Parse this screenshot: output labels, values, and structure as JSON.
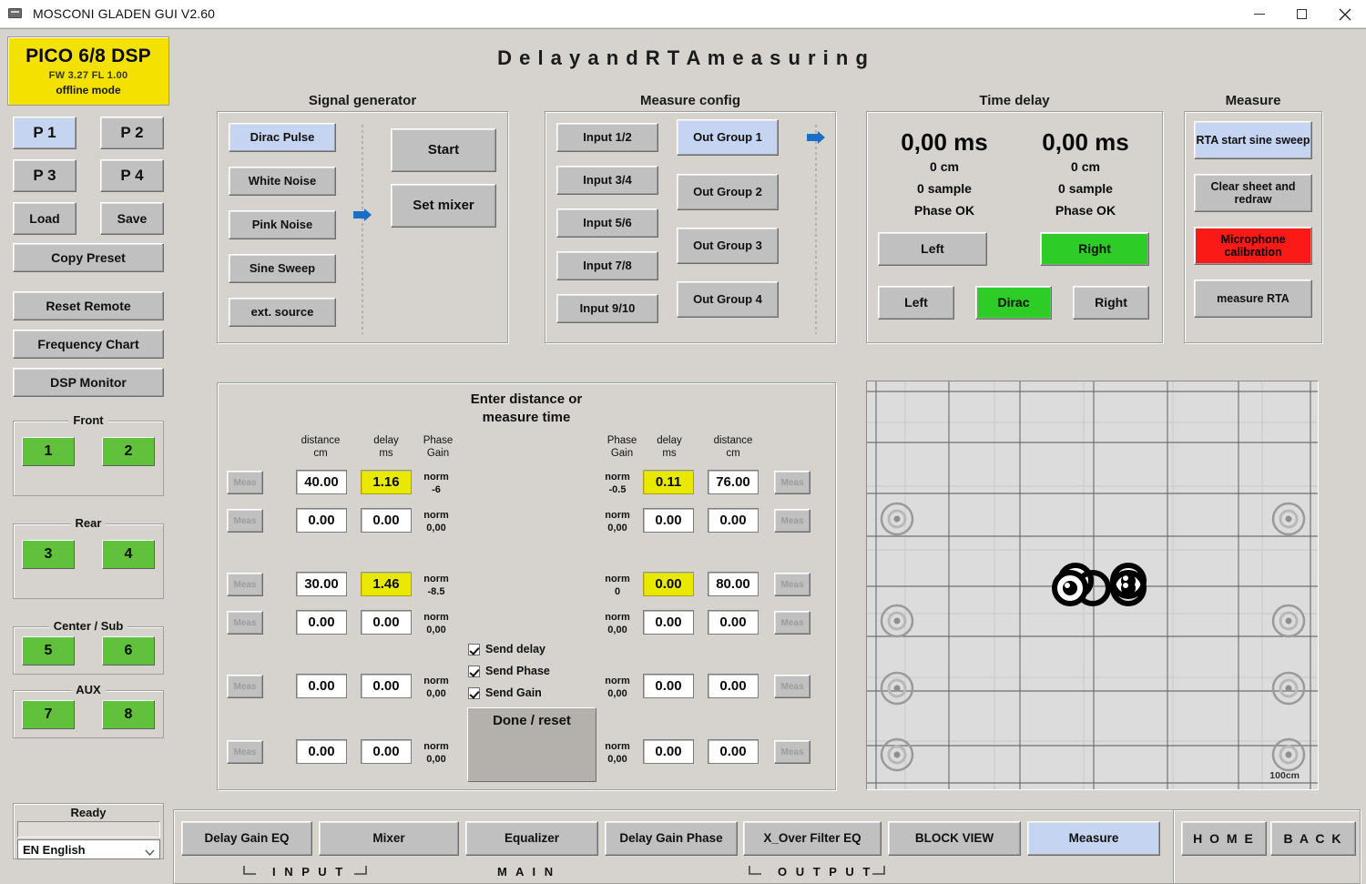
{
  "window": {
    "title": "MOSCONI GLADEN GUI V2.60",
    "minimize": "—",
    "maximize": "□",
    "close": "✕"
  },
  "page_title": "D e l a y   a n d   R T A   m e a s u r i n g",
  "device": {
    "name": "PICO 6/8 DSP",
    "firmware": "FW 3.27   FL 1.00",
    "mode": "offline mode"
  },
  "sidebar": {
    "presets": [
      "P 1",
      "P 2",
      "P 3",
      "P 4"
    ],
    "load": "Load",
    "save": "Save",
    "copy_preset": "Copy Preset",
    "reset_remote": "Reset Remote",
    "frequency_chart": "Frequency Chart",
    "dsp_monitor": "DSP Monitor",
    "channel_groups": [
      {
        "title": "Front",
        "channels": [
          "1",
          "2"
        ]
      },
      {
        "title": "Rear",
        "channels": [
          "3",
          "4"
        ]
      },
      {
        "title": "Center / Sub",
        "channels": [
          "5",
          "6"
        ]
      },
      {
        "title": "AUX",
        "channels": [
          "7",
          "8"
        ]
      }
    ],
    "status_title": "Ready",
    "status_value": "",
    "language": "EN English"
  },
  "signal_generator": {
    "title": "Signal generator",
    "sources": [
      "Dirac Pulse",
      "White Noise",
      "Pink Noise",
      "Sine Sweep",
      "ext. source"
    ],
    "selected_source": "Dirac Pulse",
    "start": "Start",
    "set_mixer": "Set mixer"
  },
  "measure_config": {
    "title": "Measure config",
    "inputs": [
      "Input 1/2",
      "Input 3/4",
      "Input 5/6",
      "Input 7/8",
      "Input 9/10"
    ],
    "out_groups": [
      "Out Group 1",
      "Out Group 2",
      "Out Group 3",
      "Out Group 4"
    ],
    "selected_out_group": "Out Group 1"
  },
  "time_delay": {
    "title": "Time delay",
    "left": {
      "ms": "0,00 ms",
      "cm": "0 cm",
      "sample": "0 sample",
      "phase": "Phase OK",
      "button": "Left"
    },
    "right": {
      "ms": "0,00 ms",
      "cm": "0 cm",
      "sample": "0 sample",
      "phase": "Phase OK",
      "button": "Right"
    },
    "row_buttons": [
      "Left",
      "Dirac",
      "Right"
    ],
    "active_row_button": "Dirac"
  },
  "measure": {
    "title": "Measure",
    "buttons": [
      {
        "label": "RTA start sine sweep",
        "state": "selected"
      },
      {
        "label": "Clear sheet and redraw",
        "state": "normal"
      },
      {
        "label": "Microphone calibration",
        "state": "alert"
      },
      {
        "label": "measure RTA",
        "state": "normal"
      }
    ]
  },
  "data_panel": {
    "title_line1": "Enter distance or",
    "title_line2": "measure time",
    "left_headers": [
      {
        "l1": "distance",
        "l2": "cm"
      },
      {
        "l1": "delay",
        "l2": "ms"
      },
      {
        "l1": "Phase",
        "l2": "Gain"
      }
    ],
    "right_headers": [
      {
        "l1": "Phase",
        "l2": "Gain"
      },
      {
        "l1": "delay",
        "l2": "ms"
      },
      {
        "l1": "distance",
        "l2": "cm"
      }
    ],
    "meas_button_label": "Meas",
    "left_rows": [
      {
        "distance": "40.00",
        "delay": "1.16",
        "delay_hl": true,
        "norm": "norm",
        "gain": "-6"
      },
      {
        "distance": "0.00",
        "delay": "0.00",
        "delay_hl": false,
        "norm": "norm",
        "gain": "0,00"
      },
      {
        "distance": "30.00",
        "delay": "1.46",
        "delay_hl": true,
        "norm": "norm",
        "gain": "-8.5"
      },
      {
        "distance": "0.00",
        "delay": "0.00",
        "delay_hl": false,
        "norm": "norm",
        "gain": "0,00"
      },
      {
        "distance": "0.00",
        "delay": "0.00",
        "delay_hl": false,
        "norm": "norm",
        "gain": "0,00"
      },
      {
        "distance": "0.00",
        "delay": "0.00",
        "delay_hl": false,
        "norm": "norm",
        "gain": "0,00"
      }
    ],
    "right_rows": [
      {
        "norm": "norm",
        "gain": "-0.5",
        "delay": "0.11",
        "delay_hl": true,
        "distance": "76.00"
      },
      {
        "norm": "norm",
        "gain": "0,00",
        "delay": "0.00",
        "delay_hl": false,
        "distance": "0.00"
      },
      {
        "norm": "norm",
        "gain": "0",
        "delay": "0.00",
        "delay_hl": true,
        "distance": "80.00"
      },
      {
        "norm": "norm",
        "gain": "0,00",
        "delay": "0.00",
        "delay_hl": false,
        "distance": "0.00"
      },
      {
        "norm": "norm",
        "gain": "0,00",
        "delay": "0.00",
        "delay_hl": false,
        "distance": "0.00"
      },
      {
        "norm": "norm",
        "gain": "0,00",
        "delay": "0.00",
        "delay_hl": false,
        "distance": "0.00"
      }
    ],
    "checkboxes": [
      {
        "label": "Send delay",
        "checked": true
      },
      {
        "label": "Send Phase",
        "checked": true
      },
      {
        "label": "Send Gain",
        "checked": true
      }
    ],
    "done_reset": "Done / reset"
  },
  "diagram": {
    "scale_label": "100cm"
  },
  "bottom": {
    "tabs": [
      {
        "label": "Delay Gain EQ",
        "state": "normal"
      },
      {
        "label": "Mixer",
        "state": "normal"
      },
      {
        "label": "Equalizer",
        "state": "normal"
      },
      {
        "label": "Delay Gain Phase",
        "state": "normal"
      },
      {
        "label": "X_Over  Filter EQ",
        "state": "normal"
      },
      {
        "label": "BLOCK VIEW",
        "state": "normal"
      },
      {
        "label": "Measure",
        "state": "selected"
      }
    ],
    "sections": [
      "I N P U T",
      "M A I N",
      "O U T P U T"
    ],
    "home": "H O M E",
    "back": "B A C K"
  },
  "colors": {
    "accent_blue": "#c5d4f0",
    "green": "#2ecc27",
    "red": "#fb1a16",
    "yellow_field": "#e8e800",
    "device_yellow": "#f5e100",
    "channel_green": "#62c13c",
    "face": "#d6d3ce",
    "button_face": "#c0c0c0"
  }
}
